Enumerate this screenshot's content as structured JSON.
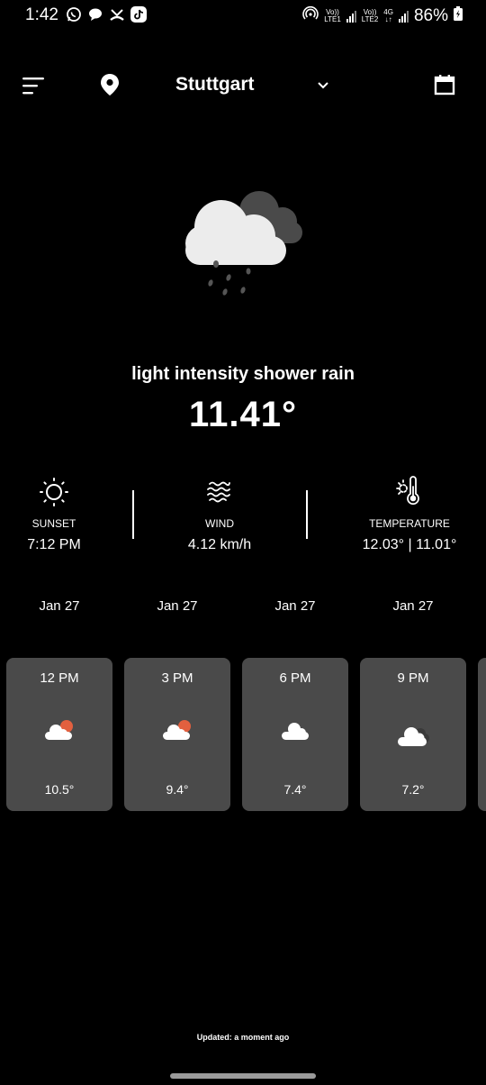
{
  "status_bar": {
    "time": "1:42",
    "sim1_label_top": "Vo))",
    "sim1_label_bottom": "LTE1",
    "sim2_label_top": "Vo))",
    "sim2_label_bottom": "LTE2",
    "network_type": "4G",
    "battery": "86%"
  },
  "header": {
    "city": "Stuttgart"
  },
  "current": {
    "condition": "light intensity shower rain",
    "temperature": "11.41°"
  },
  "stats": [
    {
      "label": "SUNSET",
      "value": "7:12 PM",
      "icon": "sun-icon"
    },
    {
      "label": "WIND",
      "value": "4.12 km/h",
      "icon": "wind-icon"
    },
    {
      "label": "TEMPERATURE",
      "value": "12.03° | 11.01°",
      "icon": "thermometer-icon"
    }
  ],
  "forecast": [
    {
      "date": "Jan 27",
      "time": "12 PM",
      "temp": "10.5°",
      "icon": "sun-behind-cloud-icon"
    },
    {
      "date": "Jan 27",
      "time": "3 PM",
      "temp": "9.4°",
      "icon": "sun-behind-cloud-icon"
    },
    {
      "date": "Jan 27",
      "time": "6 PM",
      "temp": "7.4°",
      "icon": "cloud-icon"
    },
    {
      "date": "Jan 27",
      "time": "9 PM",
      "temp": "7.2°",
      "icon": "clouds-icon"
    }
  ],
  "footer": {
    "updated": "Updated: a moment ago"
  }
}
